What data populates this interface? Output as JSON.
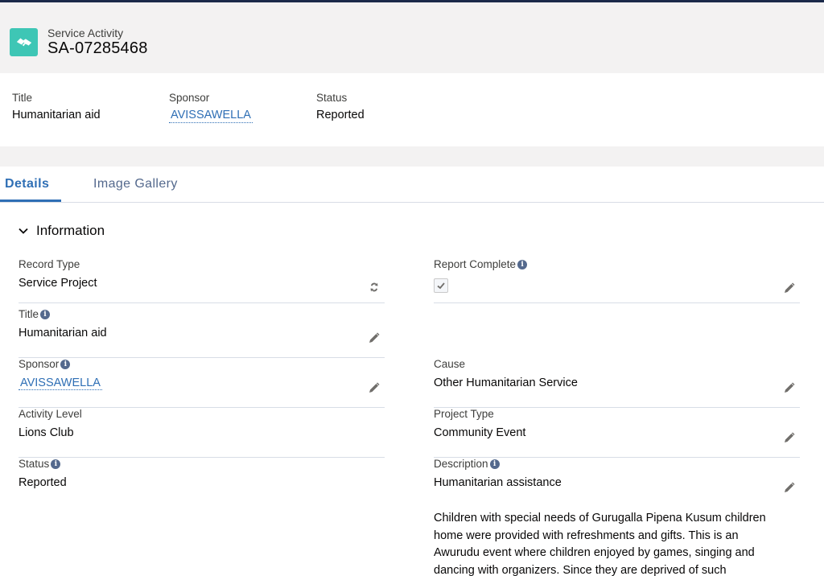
{
  "header": {
    "object_type": "Service Activity",
    "record_name": "SA-07285468"
  },
  "highlights": [
    {
      "label": "Title",
      "value": "Humanitarian aid"
    },
    {
      "label": "Sponsor",
      "value": "AVISSAWELLA"
    },
    {
      "label": "Status",
      "value": "Reported"
    }
  ],
  "tabs": [
    "Details",
    "Image Gallery"
  ],
  "section": {
    "title": "Information"
  },
  "fields": {
    "record_type": {
      "label": "Record Type",
      "value": "Service Project"
    },
    "title": {
      "label": "Title",
      "value": "Humanitarian aid"
    },
    "sponsor": {
      "label": "Sponsor",
      "value": "AVISSAWELLA"
    },
    "activity_level": {
      "label": "Activity Level",
      "value": "Lions Club"
    },
    "status": {
      "label": "Status",
      "value": "Reported"
    },
    "report_complete": {
      "label": "Report Complete",
      "checked": true
    },
    "cause": {
      "label": "Cause",
      "value": "Other Humanitarian Service"
    },
    "project_type": {
      "label": "Project Type",
      "value": "Community Event"
    },
    "description": {
      "label": "Description",
      "value": "Humanitarian assistance",
      "body_lines": [
        "Children with special needs of Gurugalla Pipena Kusum children",
        "home were provided with refreshments and gifts. This is an",
        "Awurudu event where children enjoyed by games, singing and",
        "dancing with organizers. Since they are deprived of such"
      ]
    }
  },
  "colors": {
    "accent": "#2f6fb5",
    "icon_bg": "#3ec6b5",
    "topbar": "#1b2a4a"
  }
}
